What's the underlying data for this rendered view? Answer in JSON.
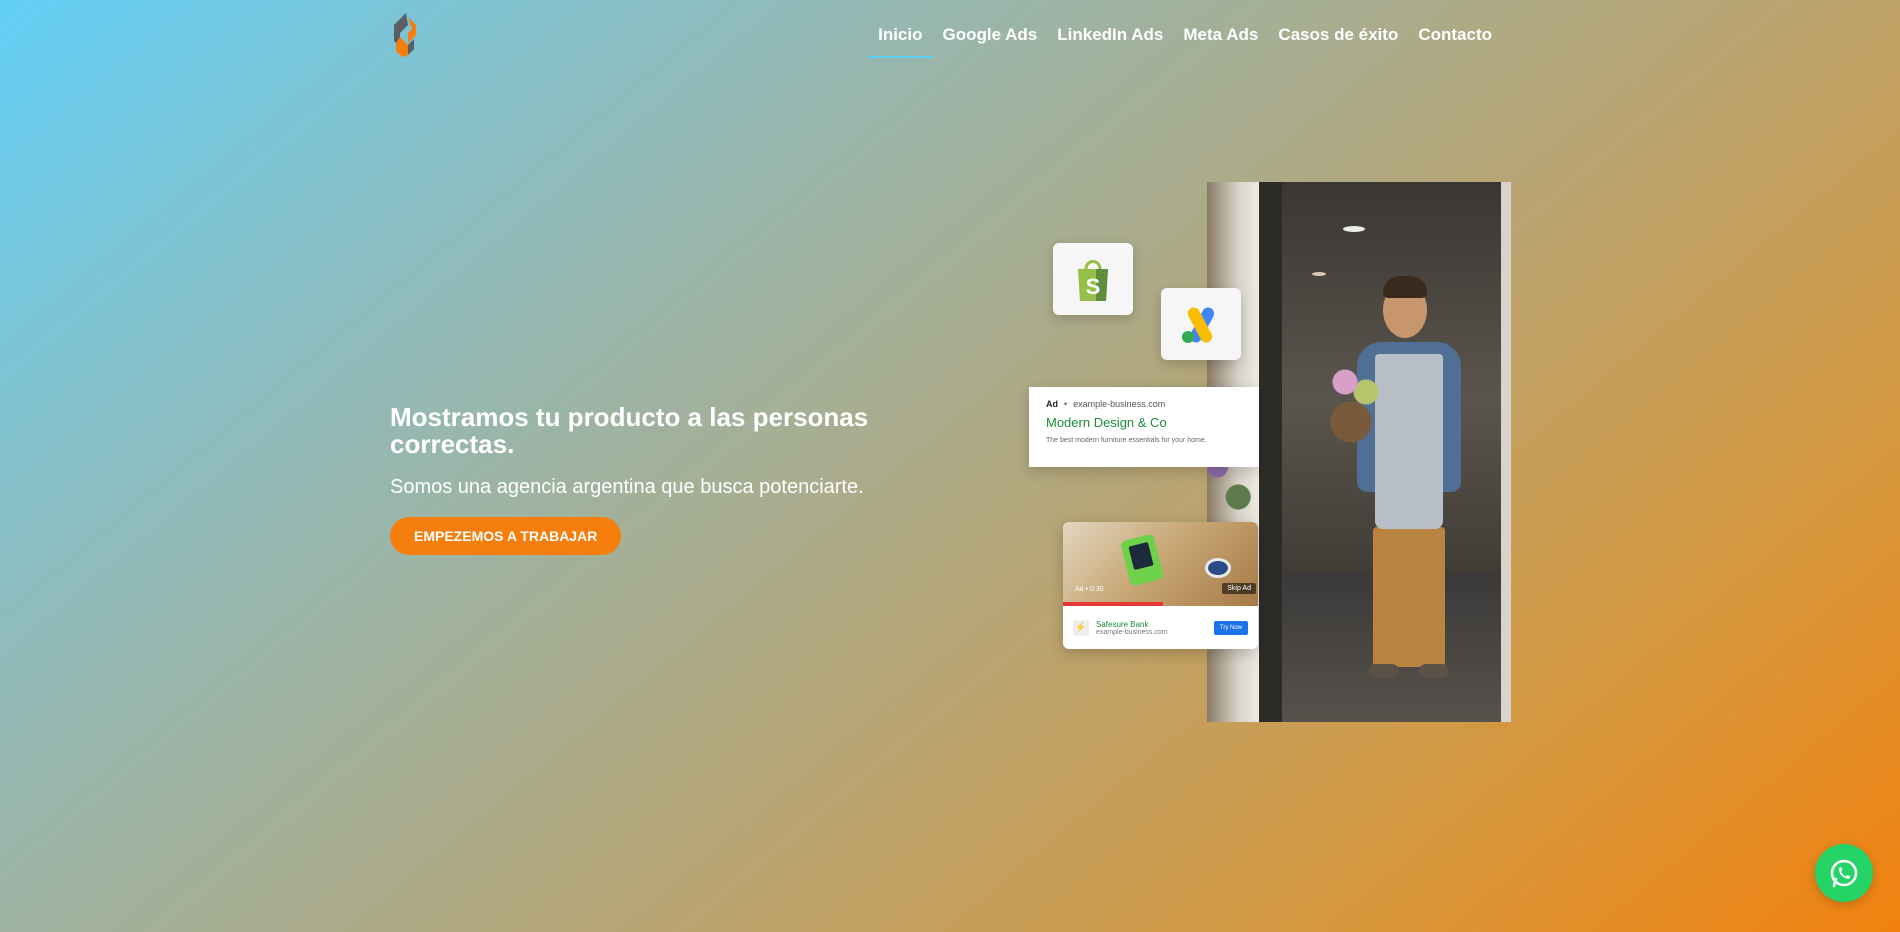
{
  "header": {
    "logo_icon": "agency-logo-icon",
    "nav": [
      {
        "label": "Inicio",
        "active": true
      },
      {
        "label": "Google Ads",
        "active": false
      },
      {
        "label": "LinkedIn Ads",
        "active": false
      },
      {
        "label": "Meta Ads",
        "active": false
      },
      {
        "label": "Casos de éxito",
        "active": false
      },
      {
        "label": "Contacto",
        "active": false
      }
    ]
  },
  "hero": {
    "title": "Mostramos tu producto a las personas correctas.",
    "subtitle": "Somos una agencia argentina que busca potenciarte.",
    "cta_label": "EMPEZEMOS A TRABAJAR"
  },
  "illustration": {
    "icons": [
      "shopify-icon",
      "google-ads-icon"
    ],
    "search_ad": {
      "tag": "Ad",
      "url": "example-business.com",
      "title": "Modern Design & Co",
      "description": "The best modern furniture essentials for your home."
    },
    "video_ad": {
      "time": "Ad • 0:30",
      "skip": "Skip Ad",
      "name": "Safesure Bank",
      "url": "example-business.com",
      "button": "Try Now"
    }
  },
  "whatsapp_icon": "whatsapp-icon",
  "colors": {
    "accent_orange": "#f67e0c",
    "nav_underline": "#5fd0f5",
    "whatsapp_green": "#25d366"
  }
}
